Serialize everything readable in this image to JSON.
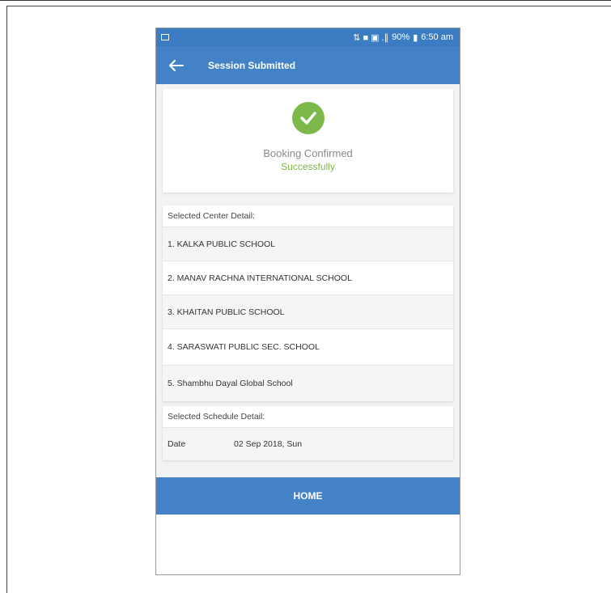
{
  "statusbar": {
    "indicators": "⇅ ■ ▣ .∥",
    "battery": "90%",
    "time": "6:50 am"
  },
  "appbar": {
    "title": "Session Submitted",
    "back_icon": "arrow-left-icon"
  },
  "confirmation": {
    "icon": "check-circle-icon",
    "line1": "Booking Confirmed",
    "line2": "Successfully",
    "color": "#7cb84a"
  },
  "center_detail": {
    "header": "Selected Center Detail:",
    "items": [
      "1. KALKA PUBLIC SCHOOL",
      "2. MANAV RACHNA INTERNATIONAL SCHOOL",
      "3. KHAITAN PUBLIC SCHOOL",
      "4. SARASWATI PUBLIC SEC. SCHOOL",
      "5. Shambhu Dayal Global School"
    ]
  },
  "schedule_detail": {
    "header": "Selected Schedule Detail:",
    "date_label": "Date",
    "date_value": "02 Sep 2018, Sun"
  },
  "home_button": {
    "label": "HOME"
  },
  "colors": {
    "primary": "#4382c6",
    "success": "#7cb84a"
  }
}
